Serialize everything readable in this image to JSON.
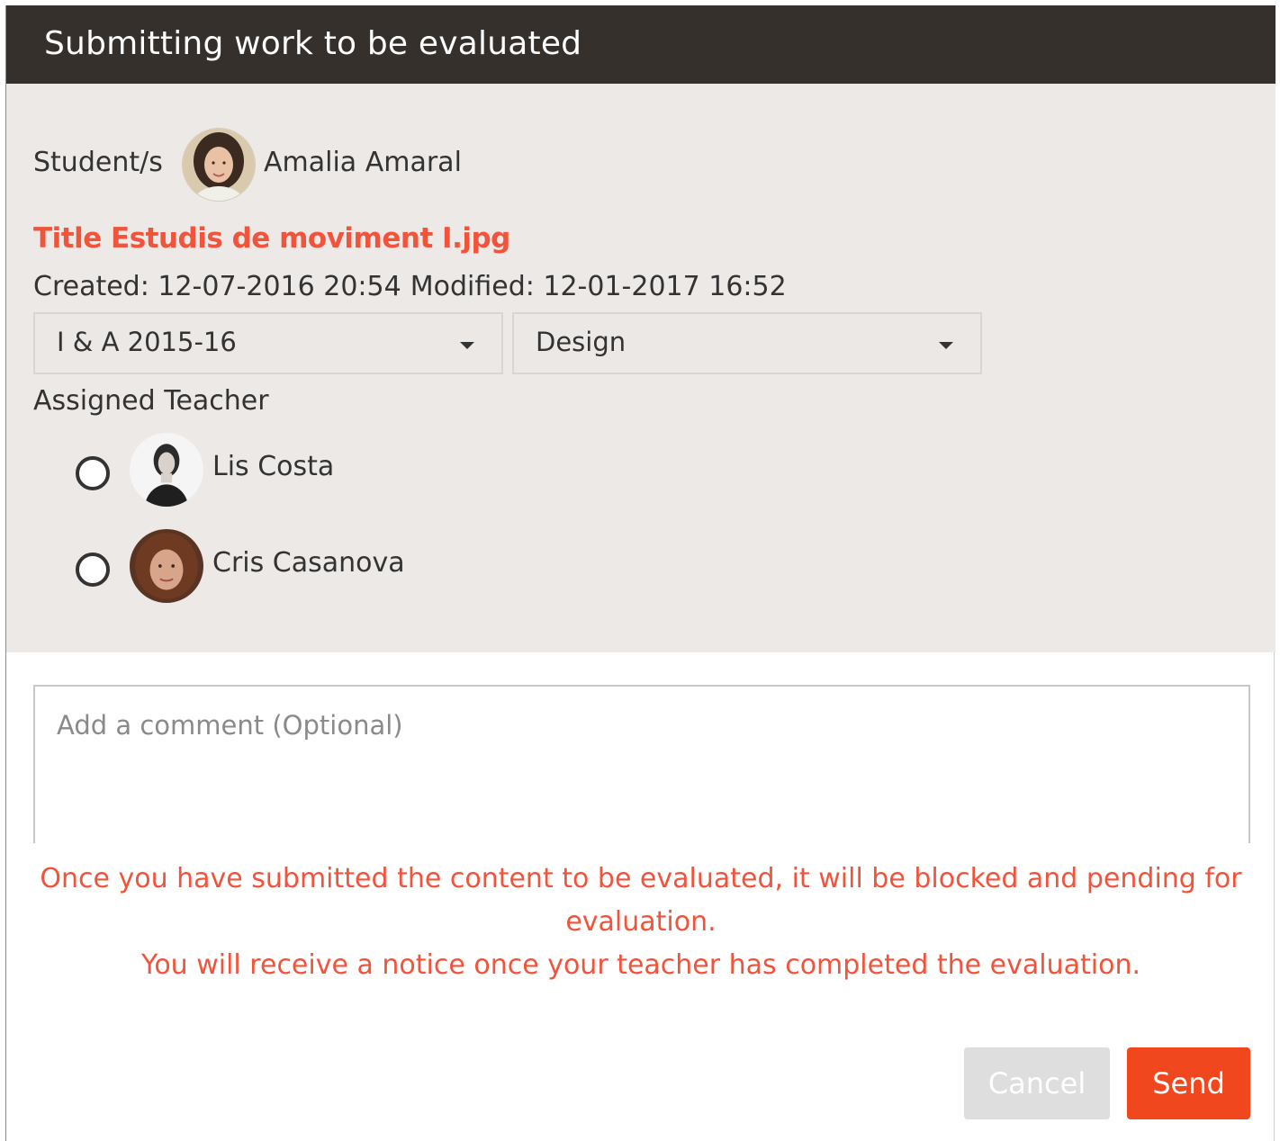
{
  "dialog": {
    "title": "Submitting work to be evaluated"
  },
  "student": {
    "label": "Student/s",
    "name": "Amalia Amaral"
  },
  "file": {
    "title": "Title Estudis de moviment I.jpg",
    "created": "Created: 12-07-2016 20:54",
    "modified": "Modified: 12-01-2017 16:52"
  },
  "selects": {
    "year": "I & A 2015-16",
    "subject": "Design"
  },
  "teachers": {
    "label": "Assigned Teacher",
    "items": [
      {
        "name": "Lis Costa",
        "selected": false
      },
      {
        "name": "Cris Casanova",
        "selected": false
      }
    ]
  },
  "comment": {
    "placeholder": "Add a comment (Optional)",
    "value": ""
  },
  "notice": {
    "line1": "Once you have submitted the content to be evaluated, it will be blocked and pending for evaluation.",
    "line2": "You will receive a notice once your teacher has completed the evaluation."
  },
  "buttons": {
    "cancel": "Cancel",
    "send": "Send"
  },
  "colors": {
    "header_bg": "#35302c",
    "accent": "#f2533b",
    "send_bg": "#f1471f",
    "panel_bg": "#ece9e6"
  }
}
